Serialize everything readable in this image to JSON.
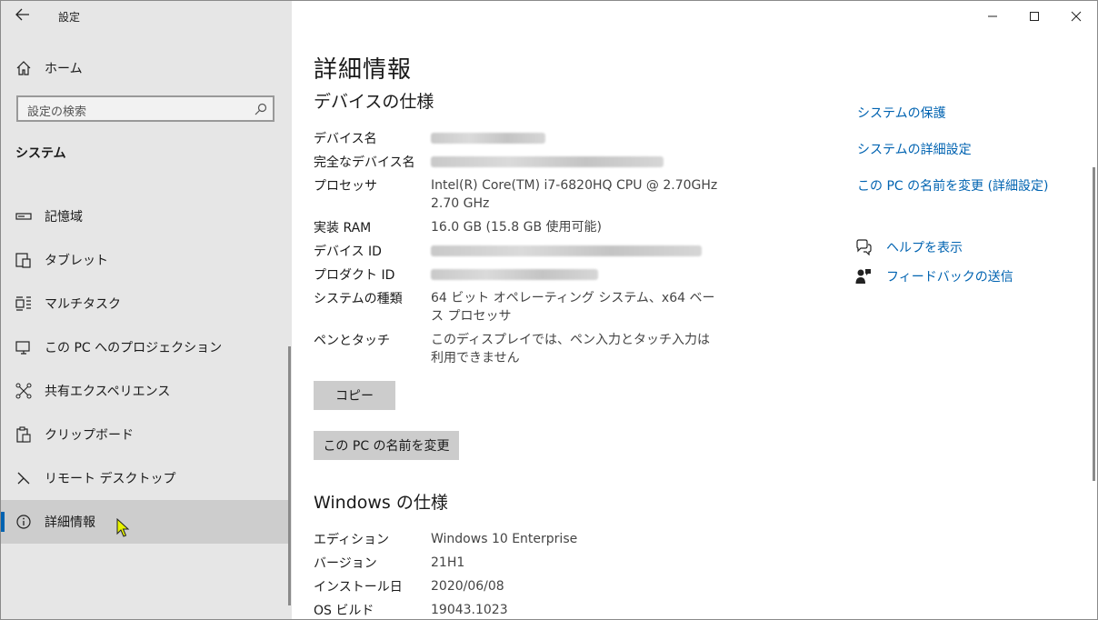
{
  "window": {
    "app_title": "設定"
  },
  "sidebar": {
    "home_label": "ホーム",
    "search_placeholder": "設定の検索",
    "section_title": "システム",
    "items": [
      {
        "label": "記憶域",
        "icon": "storage-icon"
      },
      {
        "label": "タブレット",
        "icon": "tablet-icon"
      },
      {
        "label": "マルチタスク",
        "icon": "multitask-icon"
      },
      {
        "label": "この PC へのプロジェクション",
        "icon": "projection-icon"
      },
      {
        "label": "共有エクスペリエンス",
        "icon": "share-icon"
      },
      {
        "label": "クリップボード",
        "icon": "clipboard-icon"
      },
      {
        "label": "リモート デスクトップ",
        "icon": "remote-desktop-icon"
      },
      {
        "label": "詳細情報",
        "icon": "info-icon",
        "active": true
      }
    ]
  },
  "main": {
    "title": "詳細情報",
    "device_spec_title": "デバイスの仕様",
    "device_specs": [
      {
        "label": "デバイス名",
        "value": "",
        "blurred": true
      },
      {
        "label": "完全なデバイス名",
        "value": "",
        "blurred": true
      },
      {
        "label": "プロセッサ",
        "value": "Intel(R) Core(TM) i7-6820HQ CPU @ 2.70GHz 2.70 GHz"
      },
      {
        "label": "実装 RAM",
        "value": "16.0 GB (15.8 GB 使用可能)"
      },
      {
        "label": "デバイス ID",
        "value": "",
        "blurred": true
      },
      {
        "label": "プロダクト ID",
        "value": "",
        "blurred": true
      },
      {
        "label": "システムの種類",
        "value": "64 ビット オペレーティング システム、x64 ベース プロセッサ"
      },
      {
        "label": "ペンとタッチ",
        "value": "このディスプレイでは、ペン入力とタッチ入力は利用できません"
      }
    ],
    "copy_button": "コピー",
    "rename_button": "この PC の名前を変更",
    "windows_spec_title": "Windows の仕様",
    "windows_specs": [
      {
        "label": "エディション",
        "value": "Windows 10 Enterprise"
      },
      {
        "label": "バージョン",
        "value": "21H1"
      },
      {
        "label": "インストール日",
        "value": "2020/06/08"
      },
      {
        "label": "OS ビルド",
        "value": "19043.1023"
      }
    ]
  },
  "related": {
    "links": [
      "システムの保護",
      "システムの詳細設定",
      "この PC の名前を変更 (詳細設定)"
    ],
    "help_label": "ヘルプを表示",
    "feedback_label": "フィードバックの送信"
  },
  "colors": {
    "accent": "#0063b1",
    "sidebar_bg": "#e6e6e6",
    "active_bg": "#cdcdcd",
    "button_bg": "#cccccc"
  }
}
